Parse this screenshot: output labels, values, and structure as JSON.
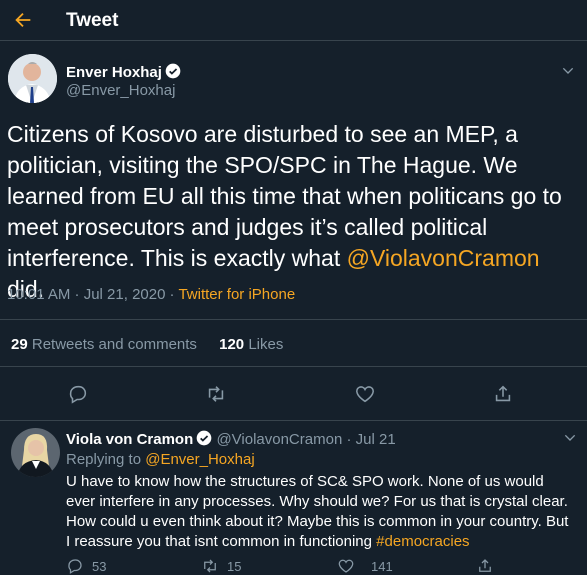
{
  "header": {
    "title": "Tweet"
  },
  "tweet": {
    "author_name": "Enver Hoxhaj",
    "author_handle": "@Enver_Hoxhaj",
    "text_part1": "Citizens of Kosovo are disturbed to see an MEP, a politician, visiting the SPO/SPC in The Hague. We learned from EU all this time that when politicans go to meet prosecutors and judges it’s called political interference. This is exactly what ",
    "mention": "@ViolavonCramon",
    "text_part2": " did.",
    "time": "10:01 AM · Jul 21, 2020",
    "separator": "·",
    "source": "Twitter for iPhone",
    "retweets_count": "29",
    "retweets_label": "Retweets and comments",
    "likes_count": "120",
    "likes_label": "Likes"
  },
  "reply": {
    "author_name": "Viola von Cramon",
    "author_handle": "@ViolavonCramon",
    "date": "· Jul 21",
    "replying_label": "Replying to",
    "replying_to": "@Enver_Hoxhaj",
    "text": "U have to know how the structures of SC& SPO work. None of us would ever interfere in any processes. Why should we? For us that is crystal clear. How could u even think about it? Maybe this is common in your country. But I reassure you that isnt common in functioning ",
    "hashtag": "#democracies",
    "reply_count": "53",
    "retweet_count": "15",
    "like_count": "141"
  },
  "colors": {
    "background": "#15202b",
    "accent": "#1da1f2",
    "orange": "#f5a623",
    "muted": "#8899a6",
    "divider": "#38444d"
  },
  "icons": [
    "back-arrow-icon",
    "verified-icon",
    "chevron-down-icon",
    "reply-icon",
    "retweet-icon",
    "like-icon",
    "share-icon"
  ]
}
